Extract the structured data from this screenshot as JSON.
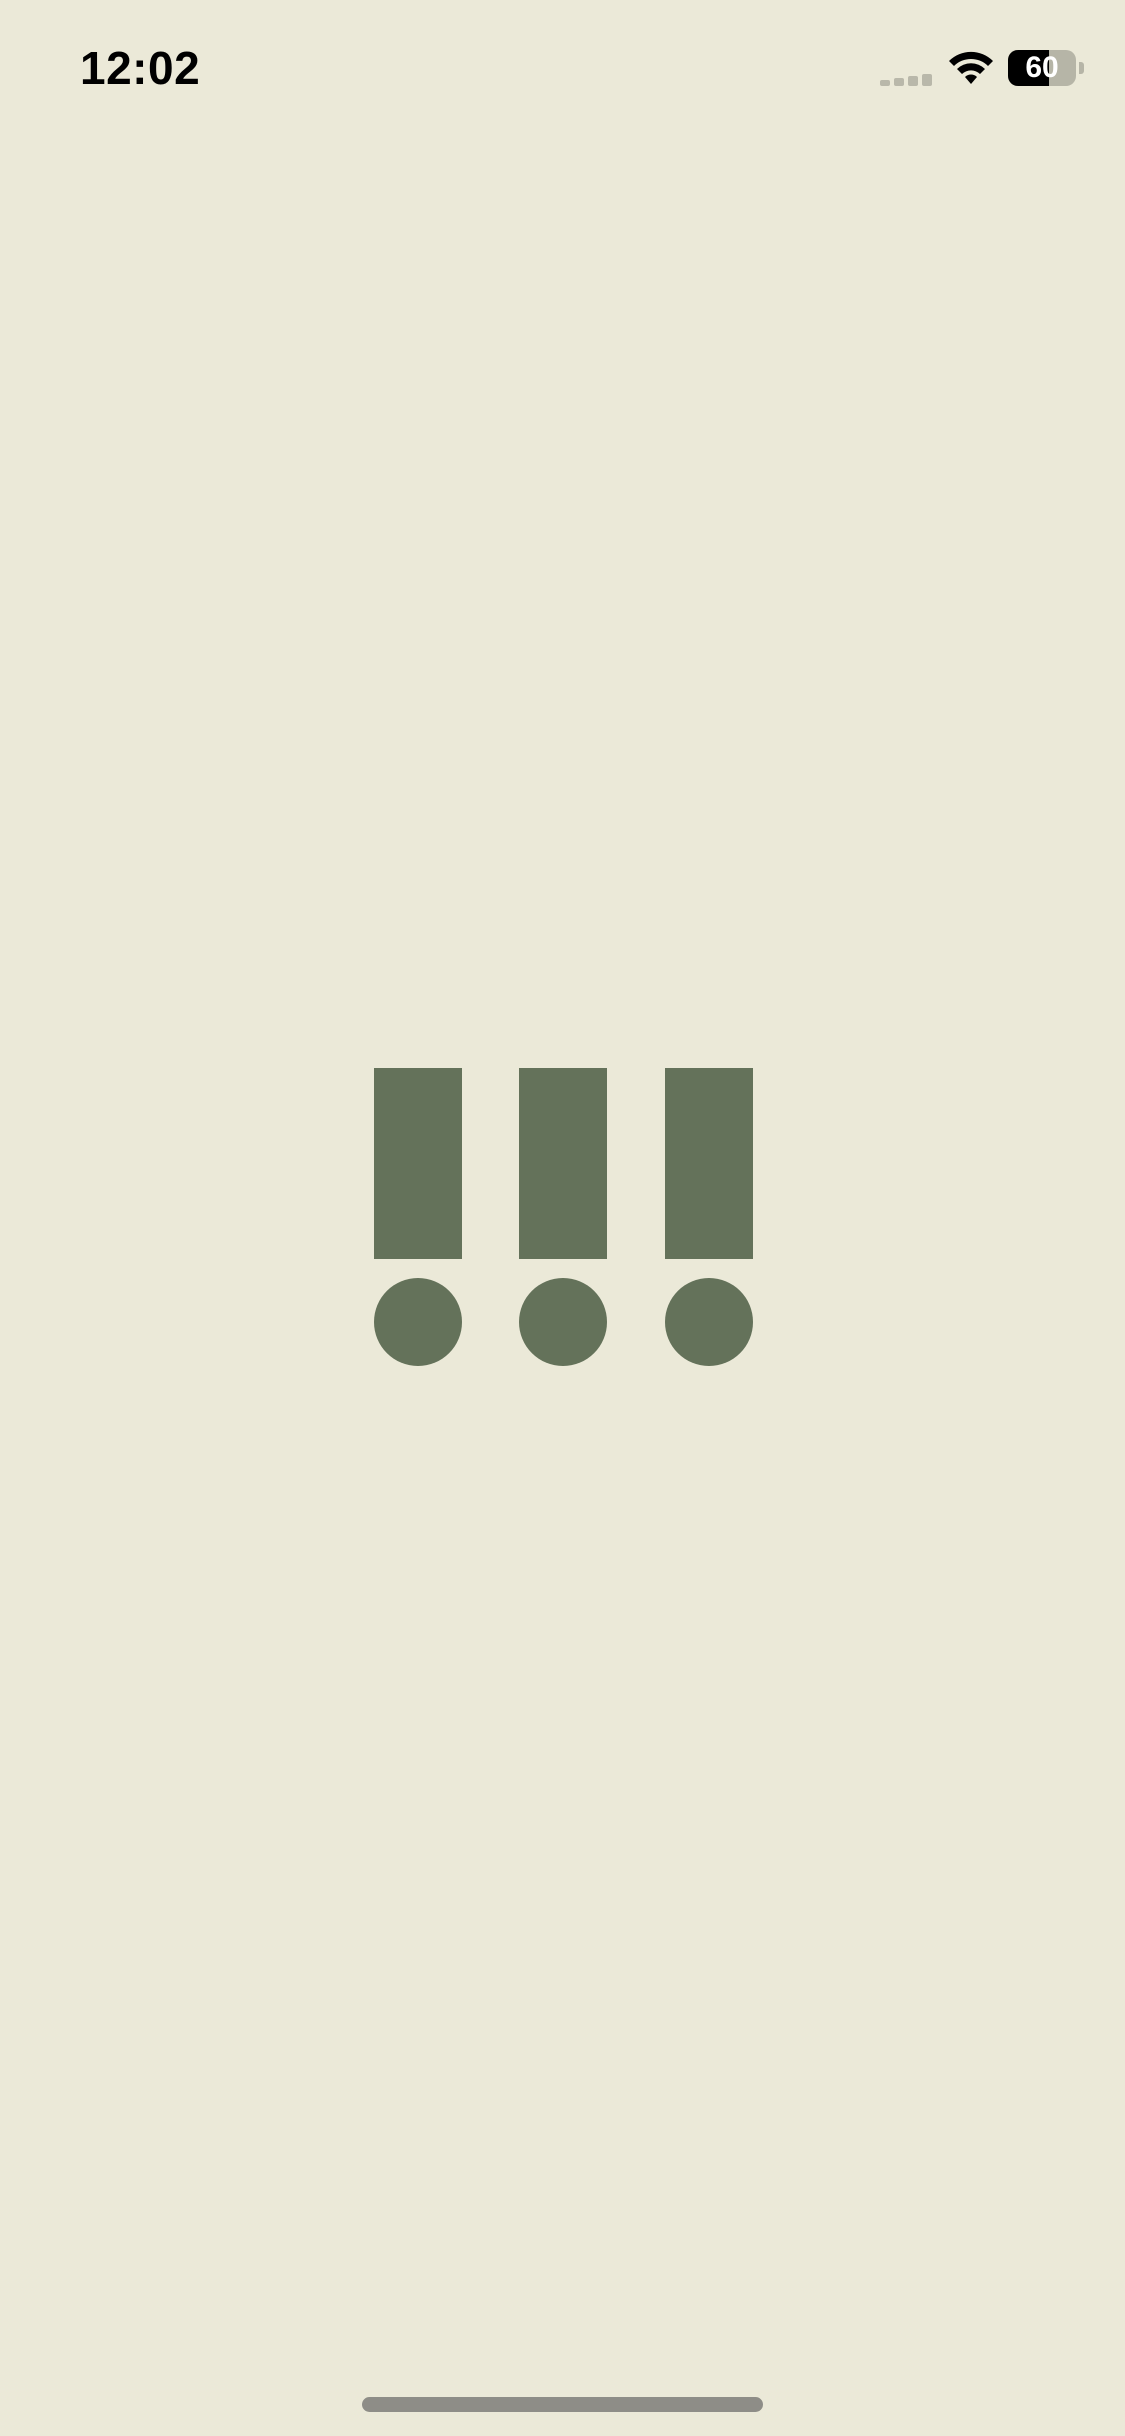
{
  "status_bar": {
    "time": "12:02",
    "signal_icon": "cellular-signal-icon",
    "wifi_icon": "wifi-icon",
    "battery_icon": "battery-icon",
    "battery_level_text": "60",
    "battery_level": 0.6
  },
  "splash": {
    "logo_icon": "three-exclamation-marks-logo",
    "logo_color": "#64725A"
  },
  "colors": {
    "background": "#EBE9D8",
    "home_indicator": "#8E8D87"
  }
}
